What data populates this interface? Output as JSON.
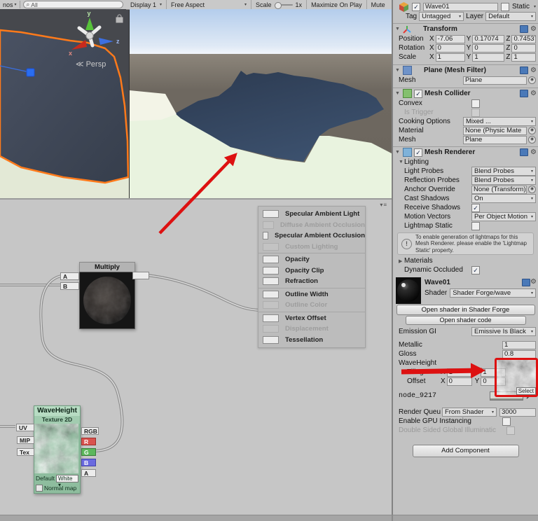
{
  "scene_view": {
    "gizmos_button": "nos",
    "search_value": "All",
    "persp_label": "Persp",
    "axes": {
      "x": "x",
      "y": "y",
      "z": "z"
    }
  },
  "game_view": {
    "toolbar": {
      "display": "Display 1",
      "aspect": "Free Aspect",
      "scale_label": "Scale",
      "scale_value": "1x",
      "maximize": "Maximize On Play",
      "mute": "Mute"
    }
  },
  "node_editor": {
    "multiply": {
      "title": "Multiply",
      "a": "A",
      "b": "B"
    },
    "wave": {
      "title": "WaveHeight",
      "subtitle": "Texture 2D",
      "uv": "UV",
      "mip": "MIP",
      "tex": "Tex",
      "rgb": "RGB",
      "r": "R",
      "g": "G",
      "b": "B",
      "a": "A",
      "default_label": "Default",
      "default_value": "White",
      "normal_label": "Normal map"
    },
    "outputs": [
      {
        "label": "Specular Ambient Light",
        "enabled": true
      },
      {
        "label": "Diffuse Ambient Occlusion",
        "enabled": false
      },
      {
        "label": "Specular Ambient Occlusion",
        "enabled": true
      },
      {
        "label": "Custom Lighting",
        "enabled": false
      },
      {
        "label": "Opacity",
        "enabled": true
      },
      {
        "label": "Opacity Clip",
        "enabled": true
      },
      {
        "label": "Refraction",
        "enabled": true
      },
      {
        "label": "Outline Width",
        "enabled": true
      },
      {
        "label": "Outline Color",
        "enabled": false
      },
      {
        "label": "Vertex Offset",
        "enabled": true
      },
      {
        "label": "Displacement",
        "enabled": false
      },
      {
        "label": "Tessellation",
        "enabled": true
      }
    ]
  },
  "insp": {
    "name": "Wave01",
    "static_label": "Static",
    "tag_label": "Tag",
    "tag_value": "Untagged",
    "layer_label": "Layer",
    "layer_value": "Default",
    "axis": {
      "x": "X",
      "y": "Y",
      "z": "Z"
    },
    "transform": {
      "title": "Transform",
      "pos_label": "Position",
      "pos": {
        "x": "-7.06",
        "y": "0.17074",
        "z": "0.74537"
      },
      "rot_label": "Rotation",
      "rot": {
        "x": "0",
        "y": "0",
        "z": "0"
      },
      "scale_label": "Scale",
      "scale": {
        "x": "1",
        "y": "1",
        "z": "1"
      }
    },
    "mesh_filter": {
      "title": "Plane (Mesh Filter)",
      "mesh_label": "Mesh",
      "mesh_value": "Plane"
    },
    "mesh_collider": {
      "title": "Mesh Collider",
      "convex_label": "Convex",
      "trigger_label": "Is Trigger",
      "cooking_label": "Cooking Options",
      "cooking_value": "Mixed ...",
      "material_label": "Material",
      "material_value": "None (Physic Mate",
      "mesh_label": "Mesh",
      "mesh_value": "Plane"
    },
    "mesh_renderer": {
      "title": "Mesh Renderer",
      "lighting_label": "Lighting",
      "light_probes_label": "Light Probes",
      "light_probes_value": "Blend Probes",
      "reflection_label": "Reflection Probes",
      "reflection_value": "Blend Probes",
      "anchor_label": "Anchor Override",
      "anchor_value": "None (Transform)",
      "cast_label": "Cast Shadows",
      "cast_value": "On",
      "receive_label": "Receive Shadows",
      "motion_label": "Motion Vectors",
      "motion_value": "Per Object Motion",
      "lightmap_label": "Lightmap Static",
      "info_text": "To enable generation of lightmaps for this Mesh Renderer. please enable the 'Lightmap Static' property.",
      "materials_label": "Materials",
      "dynamic_label": "Dynamic Occluded"
    },
    "material": {
      "name": "Wave01",
      "shader_label": "Shader",
      "shader_value": "Shader Forge/wave",
      "open_sf": "Open shader in Shader Forge",
      "open_code": "Open shader code",
      "emission_label": "Emission GI",
      "emission_value": "Emissive Is Black",
      "metallic_label": "Metallic",
      "metallic_value": "1",
      "gloss_label": "Gloss",
      "gloss_value": "0.8",
      "wave_label": "WaveHeight",
      "select_label": "Select",
      "tiling_label": "Tiling",
      "offset_label": "Offset",
      "tiling_x": "1",
      "tiling_y": "1",
      "offset_x": "0",
      "offset_y": "0",
      "node_label": "node_9217",
      "rq_label": "Render Queu",
      "rq_value": "From Shader",
      "rq_number": "3000",
      "gpu_label": "Enable GPU Instancing",
      "dsgi_label": "Double Sided Global Illuminatic",
      "add_btn": "Add Component"
    }
  }
}
